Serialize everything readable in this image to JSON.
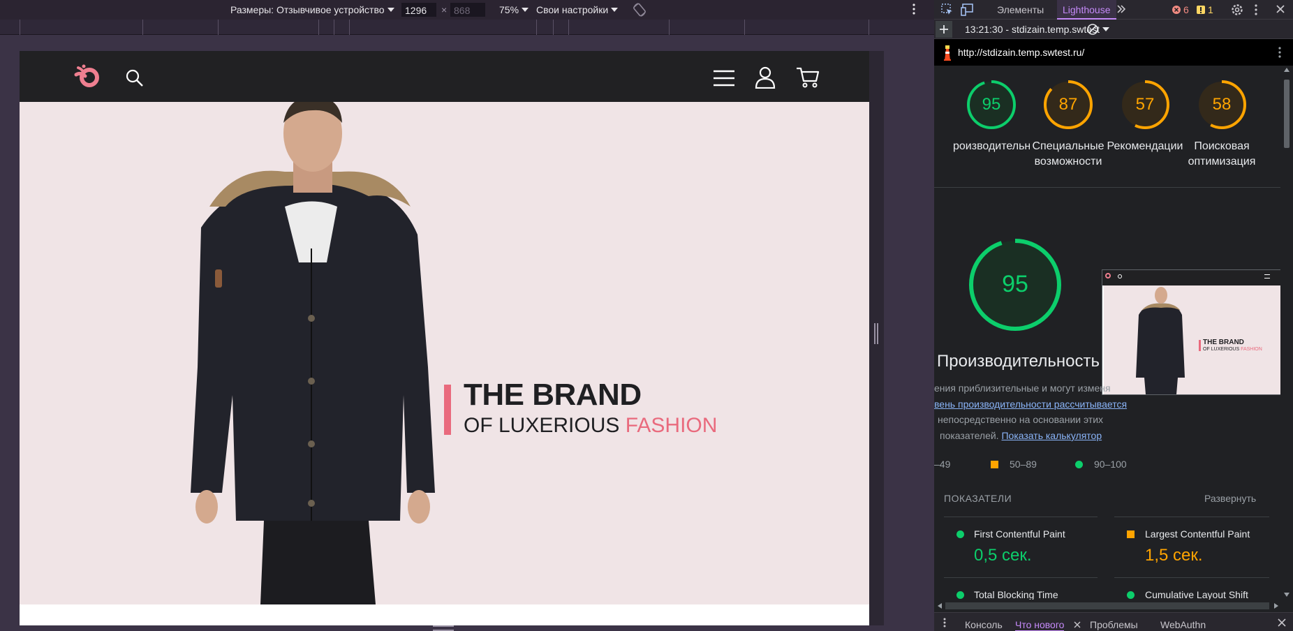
{
  "device_toolbar": {
    "dimensions_label": "Размеры: Отзывчивое устройство",
    "width": "1296",
    "times": "×",
    "height": "868",
    "zoom": "75%",
    "throttle": "Свои настройки"
  },
  "site": {
    "hero_line1": "THE BRAND",
    "hero_line2_prefix": "OF LUXERIOUS",
    "hero_line2_accent": "FASHION"
  },
  "devtools": {
    "tabs": [
      "Элементы",
      "Lighthouse"
    ],
    "active_tab": "Lighthouse",
    "errors": "6",
    "warnings": "1",
    "report_session": "13:21:30 - stdizain.temp.swtest",
    "url": "http://stdizain.temp.swtest.ru/",
    "gauges": [
      {
        "score": "95",
        "label": "Производительность",
        "label_shown": "роизводительно",
        "color": "#0cce6b"
      },
      {
        "score": "87",
        "label": "Специальные возможности",
        "label1": "Специальные",
        "label2": "возможности",
        "color": "#ffa400"
      },
      {
        "score": "57",
        "label": "Рекомендации",
        "color": "#ffa400"
      },
      {
        "score": "58",
        "label": "Поисковая оптимизация",
        "label1": "Поисковая",
        "label2": "оптимизация",
        "color": "#ffa400"
      }
    ],
    "big_score": "95",
    "big_title": "Производительность",
    "desc_line1": "ения приблизительные и могут изменя",
    "desc_link1": "вень производительности рассчитывается",
    "desc_line2": "непосредственно на основании этих",
    "desc_line3": "показателей.",
    "desc_link2": "Показать калькулятор",
    "legend": [
      "–49",
      "50–89",
      "90–100"
    ],
    "metrics_header": "ПОКАЗАТЕЛИ",
    "expand_label": "Развернуть",
    "metrics": [
      {
        "name": "First Contentful Paint",
        "value": "0,5 сек.",
        "color": "#0cce6b"
      },
      {
        "name": "Largest Contentful Paint",
        "value": "1,5 сек.",
        "color": "#ffa400"
      },
      {
        "name": "Total Blocking Time",
        "value": "",
        "color": "#0cce6b"
      },
      {
        "name": "Cumulative Layout Shift",
        "value": "",
        "color": "#0cce6b"
      }
    ],
    "thumb_line1": "THE BRAND",
    "thumb_line2_prefix": "OF LUXERIOUS",
    "thumb_line2_accent": "FASHION",
    "drawer_tabs": [
      "Консоль",
      "Что нового",
      "Проблемы",
      "WebAuthn"
    ]
  }
}
